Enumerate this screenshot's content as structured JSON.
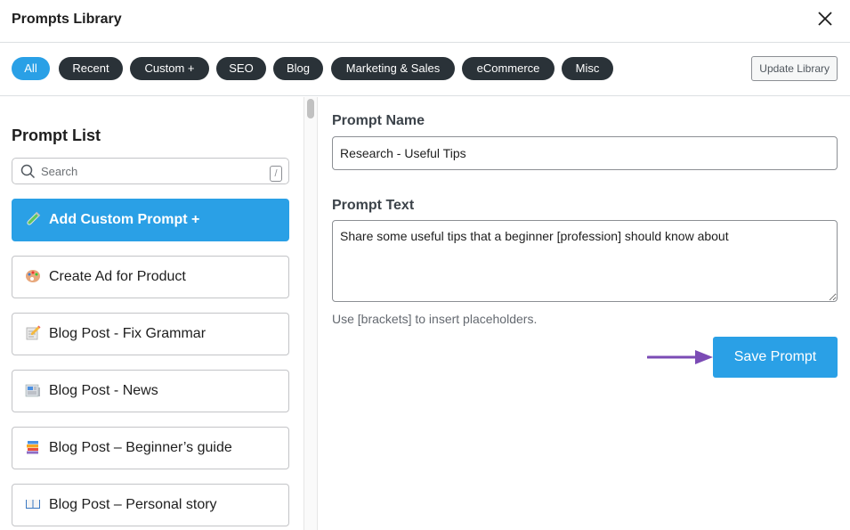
{
  "header": {
    "title": "Prompts Library"
  },
  "filters": {
    "tabs": [
      {
        "label": "All",
        "active": true
      },
      {
        "label": "Recent",
        "active": false
      },
      {
        "label": "Custom +",
        "active": false
      },
      {
        "label": "SEO",
        "active": false
      },
      {
        "label": "Blog",
        "active": false
      },
      {
        "label": "Marketing & Sales",
        "active": false
      },
      {
        "label": "eCommerce",
        "active": false
      },
      {
        "label": "Misc",
        "active": false
      }
    ],
    "update_label": "Update Library"
  },
  "sidebar": {
    "title": "Prompt List",
    "search_placeholder": "Search",
    "search_shortcut": "/",
    "items": [
      {
        "label": "Add Custom Prompt +",
        "icon": "test-tube-icon"
      },
      {
        "label": "Create Ad for Product",
        "icon": "palette-icon"
      },
      {
        "label": "Blog Post - Fix Grammar",
        "icon": "memo-icon"
      },
      {
        "label": "Blog Post - News",
        "icon": "newspaper-icon"
      },
      {
        "label": "Blog Post – Beginner’s guide",
        "icon": "books-icon"
      },
      {
        "label": "Blog Post – Personal story",
        "icon": "open-book-icon"
      }
    ]
  },
  "editor": {
    "name_label": "Prompt Name",
    "name_value": "Research - Useful Tips",
    "text_label": "Prompt Text",
    "text_value": "Share some useful tips that a beginner [profession] should know about",
    "hint": "Use [brackets] to insert placeholders.",
    "save_label": "Save Prompt"
  },
  "colors": {
    "accent": "#2aa0e6",
    "pill_dark": "#2a3238",
    "annotation_arrow": "#7b4bb5"
  }
}
